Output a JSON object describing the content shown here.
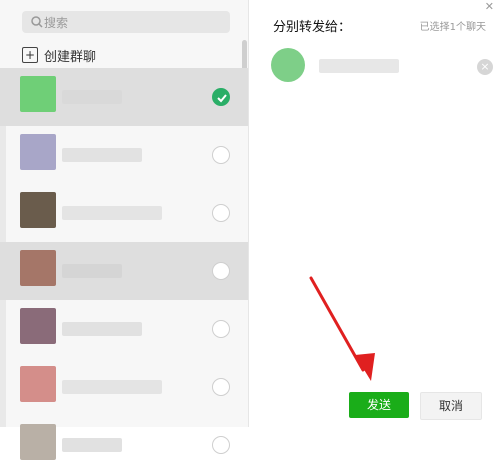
{
  "left_panel": {
    "search": {
      "placeholder": "搜索",
      "icon": "search-icon"
    },
    "create_group_label": "创建群聊",
    "contacts": [
      {
        "selected": true,
        "highlighted": true,
        "avatar_color": "#6fcf77",
        "name_color": "#d8d8d8"
      },
      {
        "selected": false,
        "highlighted": false,
        "avatar_color": "#a8a6c8",
        "name_color": "#dedede"
      },
      {
        "selected": false,
        "highlighted": false,
        "avatar_color": "#6a5c4c",
        "name_color": "#e1e1e1"
      },
      {
        "selected": false,
        "highlighted": true,
        "avatar_color": "#a57668",
        "name_color": "#d3d3d3"
      },
      {
        "selected": false,
        "highlighted": false,
        "avatar_color": "#8a6b79",
        "name_color": "#dddddd"
      },
      {
        "selected": false,
        "highlighted": false,
        "avatar_color": "#d48e8a",
        "name_color": "#e0e0e0"
      },
      {
        "selected": false,
        "highlighted": false,
        "avatar_color": "#b9b0a6",
        "name_color": "#dcdcdc"
      }
    ]
  },
  "right_panel": {
    "title": "分别转发给：",
    "selected_count_text": "已选择1个聊天",
    "close_icon": "close-icon",
    "selected_item": {
      "avatar_color": "#7ecf88",
      "remove_icon": "remove-icon"
    },
    "buttons": {
      "send": "发送",
      "cancel": "取消"
    },
    "annotation_color": "#e02020"
  }
}
